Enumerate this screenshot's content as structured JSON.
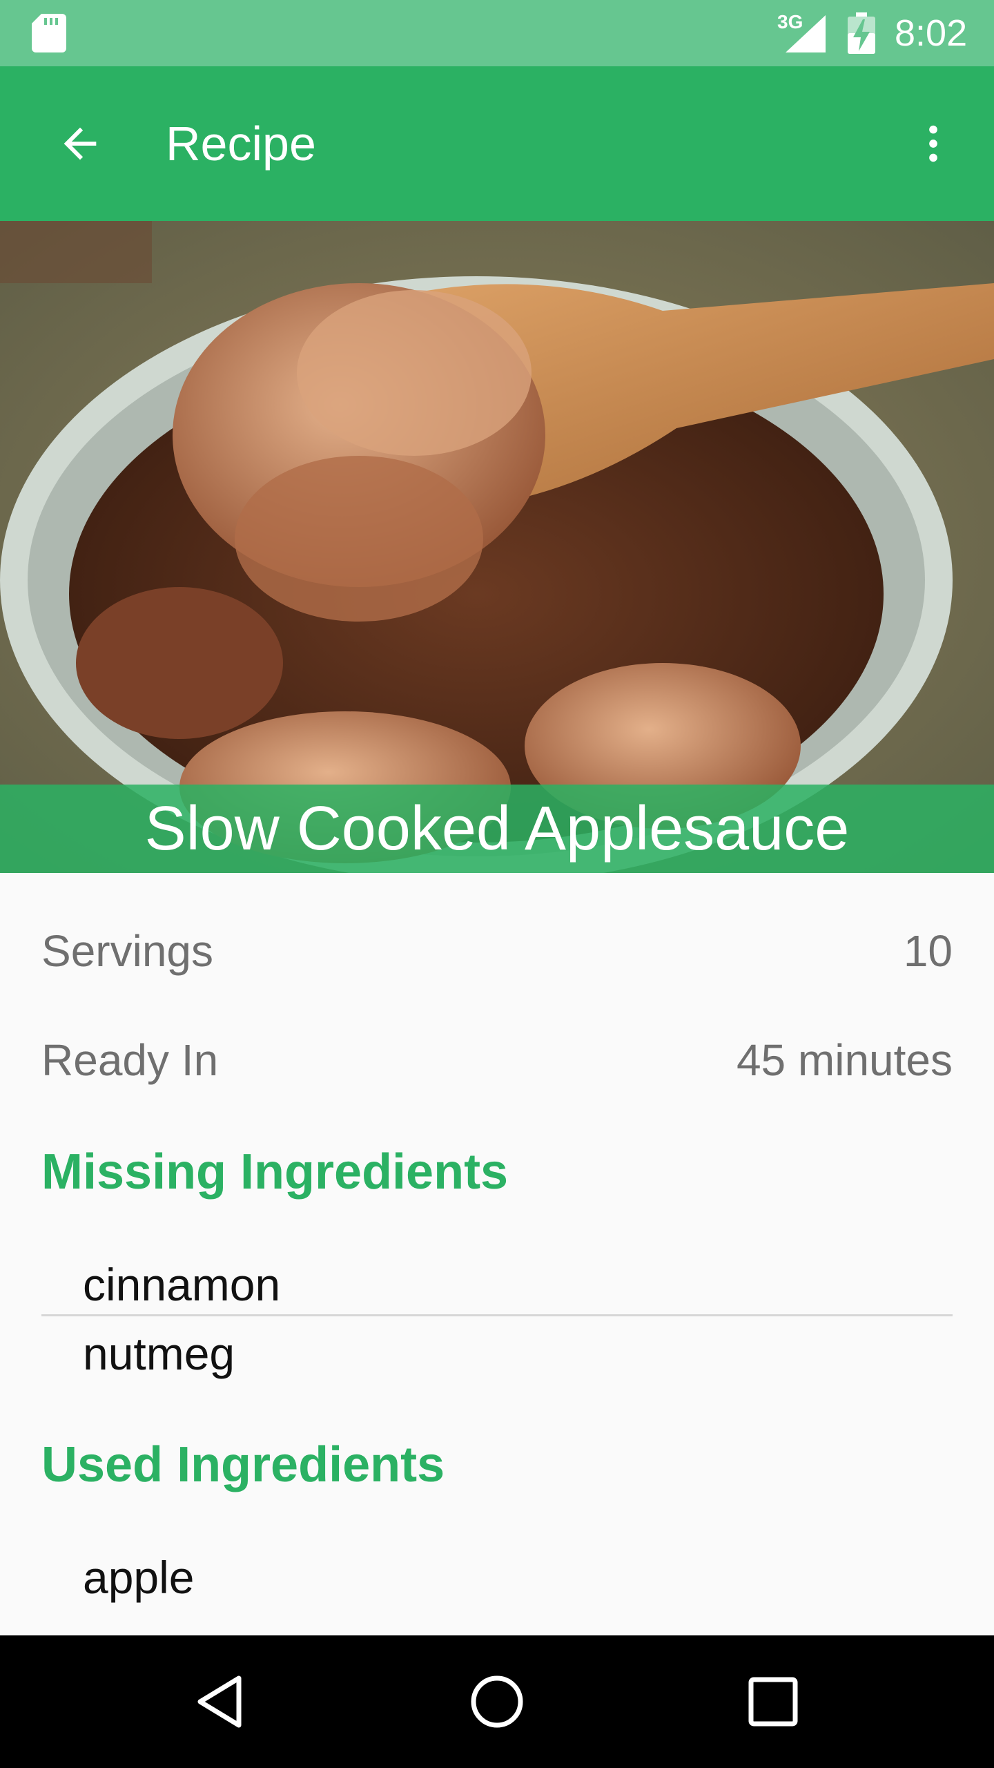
{
  "status_bar": {
    "network_type": "3G",
    "time": "8:02",
    "icons": [
      "sd-card-icon",
      "signal-icon",
      "battery-charging-icon"
    ]
  },
  "toolbar": {
    "title": "Recipe",
    "back_icon": "arrow-back-icon",
    "overflow_icon": "more-vert-icon"
  },
  "recipe": {
    "title": "Slow Cooked Applesauce"
  },
  "details": {
    "servings_label": "Servings",
    "servings_value": "10",
    "ready_label": "Ready In",
    "ready_value": "45 minutes"
  },
  "missing_ingredients": {
    "heading": "Missing Ingredients",
    "items": [
      "cinnamon",
      "nutmeg"
    ]
  },
  "used_ingredients": {
    "heading": "Used Ingredients",
    "items": [
      "apple"
    ]
  },
  "nav_bar": {
    "icons": [
      "back-triangle-icon",
      "home-circle-icon",
      "recents-square-icon"
    ]
  },
  "colors": {
    "primary": "#2bb163",
    "status_bar": "#66c690",
    "accent_text": "#2bb163"
  }
}
